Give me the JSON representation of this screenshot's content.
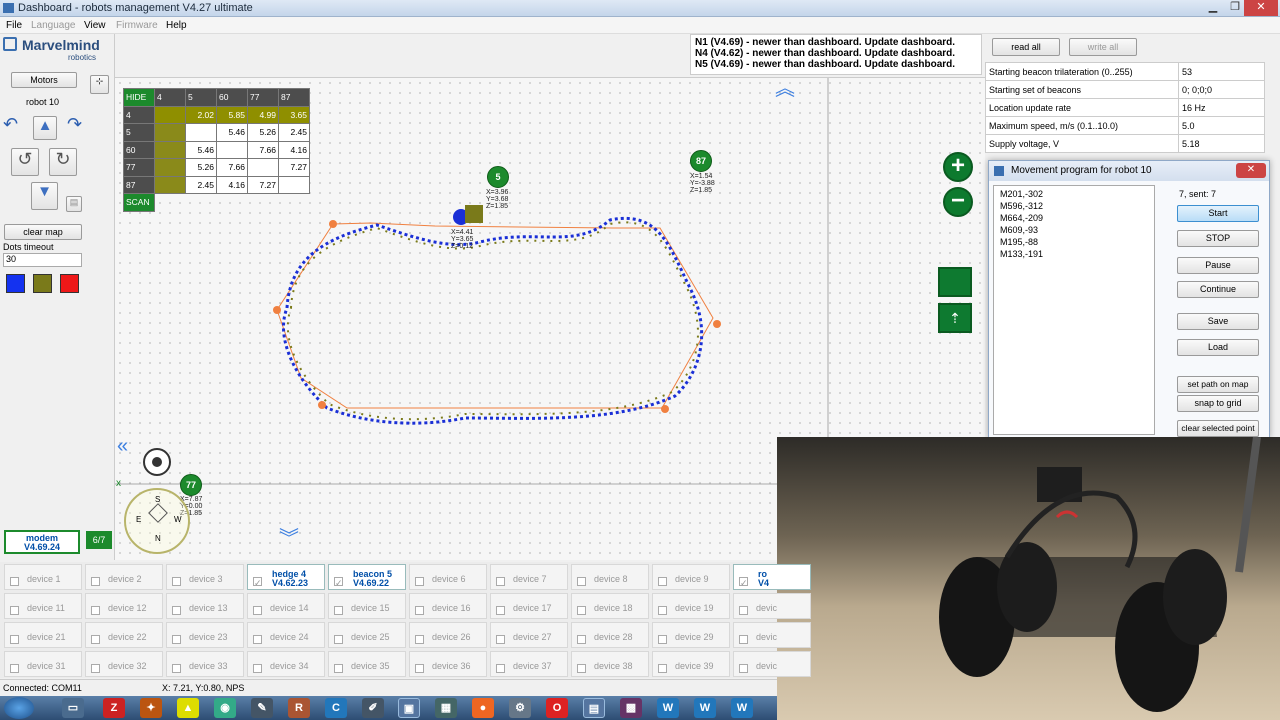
{
  "window": {
    "title": "Dashboard - robots management   V4.27  ultimate"
  },
  "menu": [
    "File",
    "Language",
    "View",
    "Firmware",
    "Help"
  ],
  "left": {
    "brand": "Marvelmind",
    "brand_sub": "robotics",
    "motors_label": "Motors",
    "robot_label": "robot 10",
    "clear_map": "clear map",
    "dots_timeout_label": "Dots timeout",
    "dots_timeout_value": "30",
    "modem_label": "modem",
    "modem_version": "V4.69.24",
    "counter": "6/7"
  },
  "notifications": [
    "N1 (V4.69)  - newer than dashboard. Update dashboard.",
    "N4 (V4.62)  - newer than dashboard. Update dashboard.",
    "N5 (V4.69)  - newer than dashboard. Update dashboard."
  ],
  "toolbar2": {
    "read_all": "read all",
    "write_all": "write all"
  },
  "properties": [
    {
      "label": "Starting beacon trilateration (0..255)",
      "value": "53"
    },
    {
      "label": "Starting set of beacons",
      "value": "0;  0;0;0"
    },
    {
      "label": "Location update rate",
      "value": "16 Hz"
    },
    {
      "label": "Maximum speed, m/s (0.1..10.0)",
      "value": "5.0"
    },
    {
      "label": "Supply voltage, V",
      "value": "5.18"
    }
  ],
  "distance_matrix": {
    "headers": [
      "HIDE",
      "4",
      "5",
      "60",
      "77",
      "87"
    ],
    "rows": [
      {
        "id": "4",
        "cells": [
          "",
          "2.02",
          "5.85",
          "4.99",
          "3.65"
        ]
      },
      {
        "id": "5",
        "cells": [
          "",
          "",
          "5.46",
          "5.26",
          "2.45"
        ]
      },
      {
        "id": "60",
        "cells": [
          "",
          "5.46",
          "",
          "7.66",
          "4.16"
        ]
      },
      {
        "id": "77",
        "cells": [
          "",
          "5.26",
          "7.66",
          "",
          "7.27"
        ]
      },
      {
        "id": "87",
        "cells": [
          "",
          "2.45",
          "4.16",
          "7.27",
          ""
        ]
      }
    ],
    "scan_label": "SCAN"
  },
  "beacons": [
    {
      "id": "5",
      "coords": [
        "X=3.96",
        "Y=3.68",
        "Z=1.85"
      ]
    },
    {
      "id": "87",
      "coords": [
        "X=1.54",
        "Y=-3.88",
        "Z=1.85"
      ]
    },
    {
      "id": "77",
      "coords": [
        "X=7.87",
        "Y=0.00",
        "Z=1.85"
      ]
    }
  ],
  "hedge_coords": [
    "X=4.41",
    "Y=3.65",
    "Z=0.12"
  ],
  "compass": {
    "n": "N",
    "s": "S",
    "e": "E",
    "w": "W"
  },
  "dialog": {
    "title": "Movement program for robot 10",
    "sent": "7, sent: 7",
    "program": [
      "M201,-302",
      "M596,-312",
      "M664,-209",
      "M609,-93",
      "M195,-88",
      "M133,-191"
    ],
    "buttons": [
      "Start",
      "STOP",
      "Pause",
      "Continue",
      "Save",
      "Load",
      "set path on map",
      "snap to grid",
      "clear selected point"
    ]
  },
  "devices": [
    {
      "label": "device 1"
    },
    {
      "label": "device 2"
    },
    {
      "label": "device 3"
    },
    {
      "label": "hedge 4",
      "version": "V4.62.23",
      "active": true
    },
    {
      "label": "beacon 5",
      "version": "V4.69.22",
      "active": true
    },
    {
      "label": "device 6"
    },
    {
      "label": "device 7"
    },
    {
      "label": "device 8"
    },
    {
      "label": "device 9"
    },
    {
      "label": "ro",
      "version": "V4",
      "active": true
    },
    {
      "label": "device 11"
    },
    {
      "label": "device 12"
    },
    {
      "label": "device 13"
    },
    {
      "label": "device 14"
    },
    {
      "label": "device 15"
    },
    {
      "label": "device 16"
    },
    {
      "label": "device 17"
    },
    {
      "label": "device 18"
    },
    {
      "label": "device 19"
    },
    {
      "label": "devic"
    },
    {
      "label": "device 21"
    },
    {
      "label": "device 22"
    },
    {
      "label": "device 23"
    },
    {
      "label": "device 24"
    },
    {
      "label": "device 25"
    },
    {
      "label": "device 26"
    },
    {
      "label": "device 27"
    },
    {
      "label": "device 28"
    },
    {
      "label": "device 29"
    },
    {
      "label": "devic"
    },
    {
      "label": "device 31"
    },
    {
      "label": "device 32"
    },
    {
      "label": "device 33"
    },
    {
      "label": "device 34"
    },
    {
      "label": "device 35"
    },
    {
      "label": "device 36"
    },
    {
      "label": "device 37"
    },
    {
      "label": "device 38"
    },
    {
      "label": "device 39"
    },
    {
      "label": "devic"
    }
  ],
  "status": {
    "connection": "Connected: COM11",
    "position": "X: 7.21, Y:0.80, NPS"
  },
  "colors": {
    "beacon_green": "#1c8a2c",
    "track_blue": "#1a2fd6",
    "accent_blue": "#004fa8"
  }
}
